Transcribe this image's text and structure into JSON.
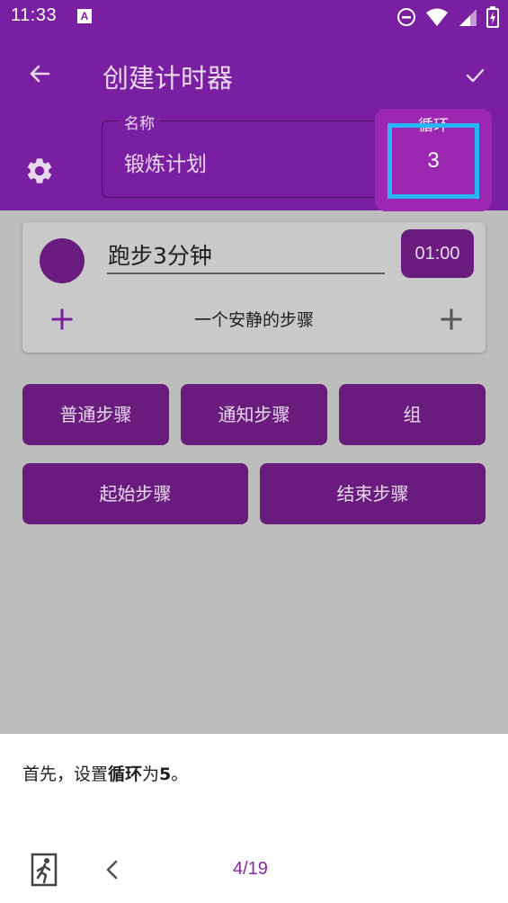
{
  "status_bar": {
    "time": "11:33",
    "notification_icon": "A",
    "icons": [
      "do-not-disturb-icon",
      "wifi-icon",
      "signal-icon",
      "battery-icon"
    ]
  },
  "app_bar": {
    "title": "创建计时器",
    "name_field": {
      "label": "名称",
      "value": "锻炼计划"
    },
    "loop_field": {
      "label": "循环",
      "value": "3"
    }
  },
  "step_card": {
    "name": "跑步3分钟",
    "duration": "01:00",
    "quiet_step_label": "一个安静的步骤"
  },
  "buttons": {
    "normal_step": "普通步骤",
    "notify_step": "通知步骤",
    "group": "组",
    "start_step": "起始步骤",
    "end_step": "结束步骤"
  },
  "tutorial": {
    "text_prefix": "首先，设置",
    "text_bold_1": "循环",
    "text_middle": "为",
    "text_bold_2": "5",
    "text_suffix": "。",
    "page": "4/19"
  },
  "colors": {
    "primary": "#7b1fa2",
    "primary_dark": "#6a1b7e",
    "highlight": "#29b6f6",
    "accent_text": "#8e24aa"
  }
}
